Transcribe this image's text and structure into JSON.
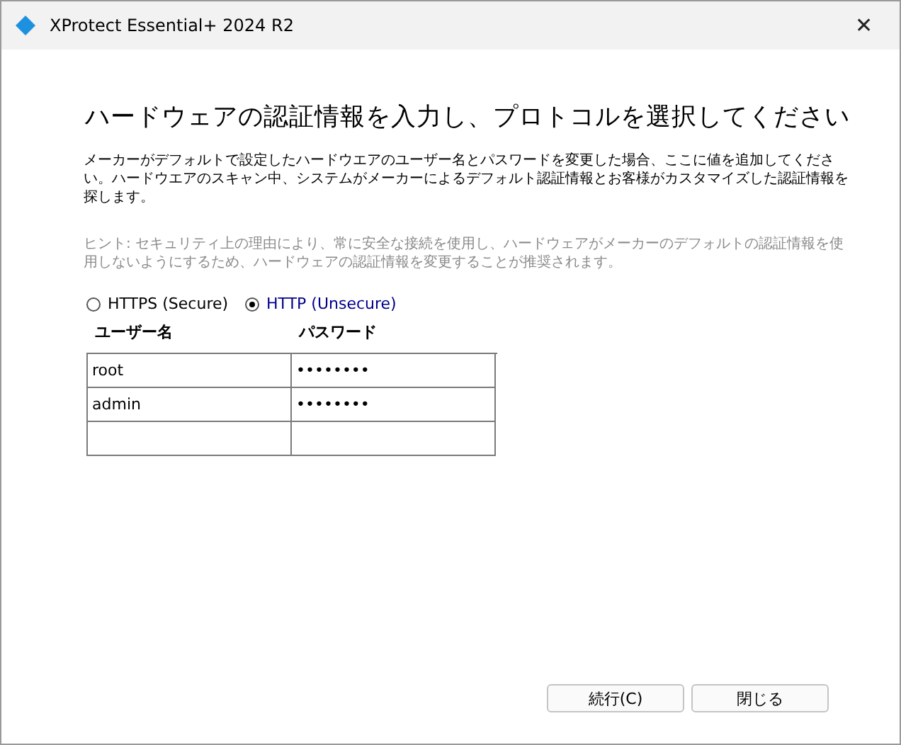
{
  "window": {
    "title": "XProtect Essential+ 2024 R2",
    "close": "✕"
  },
  "heading": "ハードウェアの認証情報を入力し、プロトコルを選択してください",
  "description": "メーカーがデフォルトで設定したハードウエアのユーザー名とパスワードを変更した場合、ここに値を追加してください。ハードウエアのスキャン中、システムがメーカーによるデフォルト認証情報とお客様がカスタマイズした認証情報を探します。",
  "hint": "ヒント: セキュリティ上の理由により、常に安全な接続を使用し、ハードウェアがメーカーのデフォルトの認証情報を使用しないようにするため、ハードウェアの認証情報を変更することが推奨されます。",
  "protocols": [
    {
      "label": "HTTPS (Secure)",
      "selected": false
    },
    {
      "label": "HTTP (Unsecure)",
      "selected": true
    }
  ],
  "table": {
    "columns": [
      "ユーザー名",
      "パスワード"
    ],
    "rows": [
      [
        "root",
        "••••••••"
      ],
      [
        "admin",
        "••••••••"
      ]
    ]
  },
  "buttons": [
    "続行(C)",
    "閉じる"
  ]
}
